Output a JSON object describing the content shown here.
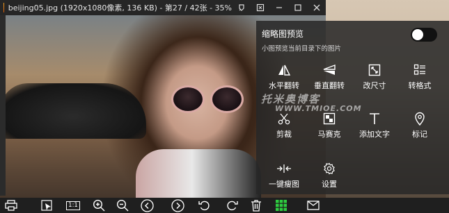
{
  "window": {
    "title": "beijing05.jpg (1920x1080像素, 136 KB) - 第27 / 42张 - 35%"
  },
  "panel": {
    "title": "缩略图预览",
    "subtitle": "小图预览当前目录下的图片",
    "toggle_state": "off",
    "tools": [
      {
        "label": "水平翻转",
        "icon": "flip-horizontal-icon"
      },
      {
        "label": "垂直翻转",
        "icon": "flip-vertical-icon"
      },
      {
        "label": "改尺寸",
        "icon": "resize-icon"
      },
      {
        "label": "转格式",
        "icon": "convert-format-icon"
      },
      {
        "label": "剪裁",
        "icon": "scissors-icon"
      },
      {
        "label": "马赛克",
        "icon": "mosaic-icon"
      },
      {
        "label": "添加文字",
        "icon": "text-icon"
      },
      {
        "label": "标记",
        "icon": "location-pin-icon"
      },
      {
        "label": "一键瘦图",
        "icon": "compress-icon"
      },
      {
        "label": "设置",
        "icon": "gear-icon"
      }
    ]
  },
  "watermark": {
    "line1": "托米奥博客",
    "line2": "WWW.TMIOE.COM"
  },
  "toolbar": {
    "items": [
      "print-icon",
      "select-icon",
      "actual-size-icon",
      "zoom-in-icon",
      "zoom-out-icon",
      "previous-icon",
      "next-icon",
      "rotate-left-icon",
      "rotate-right-icon",
      "delete-icon",
      "grid-icon",
      "mail-icon"
    ],
    "actual_size_label": "1:1"
  },
  "colors": {
    "accent_green": "#2ecc40",
    "panel_bg": "#282828",
    "titlebar_bg": "#262626"
  }
}
